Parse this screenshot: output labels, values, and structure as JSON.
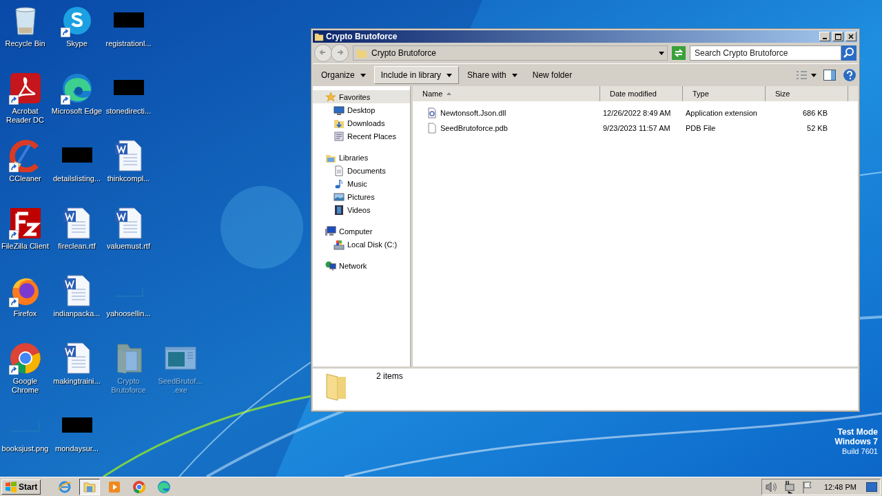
{
  "desktop_rows": [
    [
      {
        "label": "Recycle Bin",
        "kind": "recycle",
        "shortcut": false,
        "dimmed": false
      },
      {
        "label": "Skype",
        "kind": "skype",
        "shortcut": true,
        "dimmed": false
      },
      {
        "label": "registrationl...",
        "kind": "redacted",
        "shortcut": false,
        "dimmed": false
      }
    ],
    [
      {
        "label": "Acrobat Reader DC",
        "kind": "acrobat",
        "shortcut": true,
        "dimmed": false
      },
      {
        "label": "Microsoft Edge",
        "kind": "edge",
        "shortcut": true,
        "dimmed": false
      },
      {
        "label": "stonedirecti...",
        "kind": "redacted",
        "shortcut": false,
        "dimmed": false
      }
    ],
    [
      {
        "label": "CCleaner",
        "kind": "ccleaner",
        "shortcut": true,
        "dimmed": false
      },
      {
        "label": "detailslisting...",
        "kind": "redacted",
        "shortcut": false,
        "dimmed": false
      },
      {
        "label": "thinkcompl...",
        "kind": "word",
        "shortcut": false,
        "dimmed": false
      }
    ],
    [
      {
        "label": "FileZilla Client",
        "kind": "filezilla",
        "shortcut": true,
        "dimmed": false
      },
      {
        "label": "fireclean.rtf",
        "kind": "word",
        "shortcut": false,
        "dimmed": false
      },
      {
        "label": "valuemust.rtf",
        "kind": "word",
        "shortcut": false,
        "dimmed": false
      }
    ],
    [
      {
        "label": "Firefox",
        "kind": "firefox",
        "shortcut": true,
        "dimmed": false
      },
      {
        "label": "indianpacka...",
        "kind": "word",
        "shortcut": false,
        "dimmed": false
      },
      {
        "label": "yahoosellin...",
        "kind": "blank",
        "shortcut": false,
        "dimmed": false
      }
    ],
    [
      {
        "label": "Google Chrome",
        "kind": "chrome",
        "shortcut": true,
        "dimmed": false
      },
      {
        "label": "makingtraini...",
        "kind": "word",
        "shortcut": false,
        "dimmed": false
      },
      {
        "label": "Crypto Brutoforce",
        "kind": "folder",
        "shortcut": false,
        "dimmed": true
      },
      {
        "label": "SeedBrutof... .exe",
        "kind": "exe",
        "shortcut": false,
        "dimmed": true
      }
    ],
    [
      {
        "label": "booksjust.png",
        "kind": "blank",
        "shortcut": false,
        "dimmed": false
      },
      {
        "label": "mondaysur...",
        "kind": "redacted",
        "shortcut": false,
        "dimmed": false
      }
    ]
  ],
  "explorer": {
    "title": "Crypto Brutoforce",
    "address": "Crypto Brutoforce",
    "search": {
      "placeholder": "Search Crypto Brutoforce"
    },
    "toolbar": [
      {
        "label": "Organize",
        "dropdown": true,
        "highlighted": false
      },
      {
        "label": "Include in library",
        "dropdown": true,
        "highlighted": true
      },
      {
        "label": "Share with",
        "dropdown": true,
        "highlighted": false
      },
      {
        "label": "New folder",
        "dropdown": false,
        "highlighted": false
      }
    ],
    "nav": [
      {
        "label": "Favorites",
        "kind": "star",
        "selected": true,
        "children": [
          {
            "label": "Desktop",
            "kind": "desktop",
            "selected": false
          },
          {
            "label": "Downloads",
            "kind": "downloads",
            "selected": false
          },
          {
            "label": "Recent Places",
            "kind": "recent",
            "selected": false
          }
        ]
      },
      {
        "label": "Libraries",
        "kind": "library",
        "selected": false,
        "children": [
          {
            "label": "Documents",
            "kind": "documents",
            "selected": false
          },
          {
            "label": "Music",
            "kind": "music",
            "selected": false
          },
          {
            "label": "Pictures",
            "kind": "pictures",
            "selected": false
          },
          {
            "label": "Videos",
            "kind": "videos",
            "selected": false
          }
        ]
      },
      {
        "label": "Computer",
        "kind": "computer",
        "selected": false,
        "children": [
          {
            "label": "Local Disk (C:)",
            "kind": "disk",
            "selected": false
          }
        ]
      },
      {
        "label": "Network",
        "kind": "network",
        "selected": false
      }
    ],
    "columns": [
      {
        "label": "Name",
        "sorted": true
      },
      {
        "label": "Date modified",
        "sorted": false
      },
      {
        "label": "Type",
        "sorted": false
      },
      {
        "label": "Size",
        "sorted": false
      }
    ],
    "rows": [
      {
        "kind": "dll",
        "name": "Newtonsoft.Json.dll",
        "date": "12/26/2022 8:49 AM",
        "type": "Application extension",
        "size": "686 KB"
      },
      {
        "kind": "file",
        "name": "SeedBrutoforce.pdb",
        "date": "9/23/2023 11:57 AM",
        "type": "PDB File",
        "size": "52 KB"
      }
    ],
    "status": "2 items"
  },
  "test_mode": [
    "Test Mode",
    "Windows 7",
    "Build 7601"
  ],
  "taskbar": {
    "start": "Start",
    "apps": [
      {
        "kind": "ie",
        "selected": false
      },
      {
        "kind": "explorer",
        "selected": true
      },
      {
        "kind": "media",
        "selected": false
      },
      {
        "kind": "chrome",
        "selected": false
      },
      {
        "kind": "edge",
        "selected": false
      }
    ],
    "tray": [
      {
        "kind": "volume"
      },
      {
        "kind": "network"
      },
      {
        "kind": "flag"
      }
    ],
    "clock": "12:48 PM"
  }
}
